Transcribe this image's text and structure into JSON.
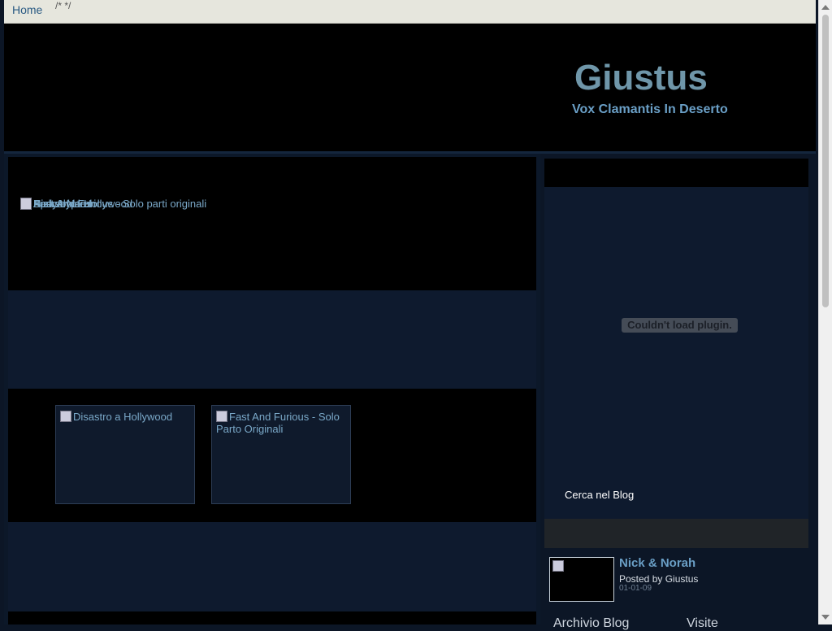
{
  "navbar": {
    "home_label": "Home",
    "comment_text": "/* */"
  },
  "header": {
    "title": "Giustus",
    "tagline": "Vox Clamantis In Deserto"
  },
  "slider": {
    "overlapping_labels": [
      "Fast And Furious - Solo parti originali",
      "Disastro a Hollywood",
      "Nick & Norah",
      "Apocalypto",
      "Body of Lies"
    ]
  },
  "featured": [
    {
      "label": "Disastro a Hollywood"
    },
    {
      "label": "Fast And Furious - Solo Parto Originali"
    }
  ],
  "sidebar": {
    "plugin_message": "Couldn't load plugin.",
    "search_label": "Cerca nel Blog",
    "recent_post": {
      "title": "Nick & Norah",
      "byline": "Posted by Giustus",
      "date": "01-01-09"
    },
    "widget_titles": [
      "Archivio Blog",
      "Visite"
    ]
  },
  "colors": {
    "navbar_bg": "#e6e6dd",
    "page_bg": "#0c1626",
    "title": "#6f96a9",
    "link": "#6a9fc6"
  }
}
